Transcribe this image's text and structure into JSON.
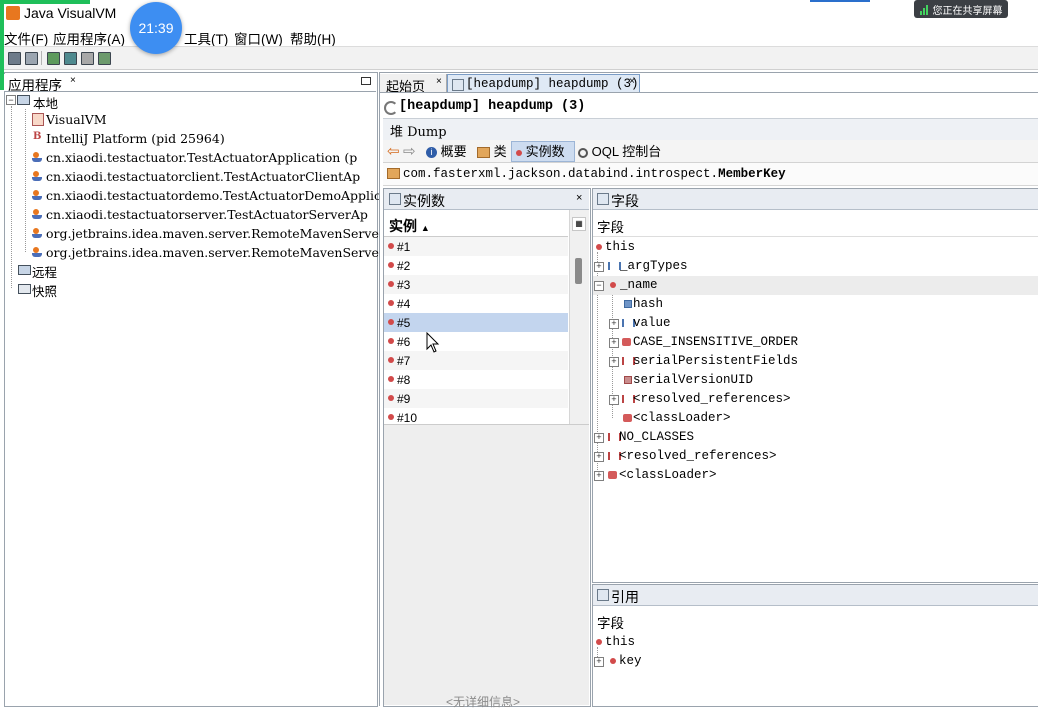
{
  "window": {
    "title": "Java VisualVM",
    "clock": "21:39",
    "share_notice": "您正在共享屏幕"
  },
  "menu": [
    {
      "label": "文件(F)"
    },
    {
      "label": "应用程序(A)"
    },
    {
      "label": "工具(T)"
    },
    {
      "label": "窗口(W)"
    },
    {
      "label": "帮助(H)"
    }
  ],
  "left_panel": {
    "tab_label": "应用程序",
    "tab_close": "×",
    "local_label": "本地",
    "apps": [
      {
        "label": "VisualVM",
        "icon": "visualvm-icon"
      },
      {
        "label": "IntelliJ Platform (pid 25964)",
        "icon": "intellij-icon"
      },
      {
        "label": "cn.xiaodi.testactuator.TestActuatorApplication (p",
        "icon": "java-process-icon"
      },
      {
        "label": "cn.xiaodi.testactuatorclient.TestActuatorClientAp",
        "icon": "java-process-icon"
      },
      {
        "label": "cn.xiaodi.testactuatordemo.TestActuatorDemoApplic",
        "icon": "java-process-icon"
      },
      {
        "label": "cn.xiaodi.testactuatorserver.TestActuatorServerAp",
        "icon": "java-process-icon"
      },
      {
        "label": "org.jetbrains.idea.maven.server.RemoteMavenServer",
        "icon": "java-process-icon"
      },
      {
        "label": "org.jetbrains.idea.maven.server.RemoteMavenServer",
        "icon": "java-process-icon"
      }
    ],
    "remote_label": "远程",
    "snapshots_label": "快照"
  },
  "doc_tabs": [
    {
      "label": "起始页",
      "close": "×"
    },
    {
      "label": "[heapdump] heapdump (3)",
      "close": "×"
    }
  ],
  "heapdump": {
    "title": "[heapdump] heapdump (3)",
    "dump_label": "堆 Dump",
    "nav": {
      "summary": "概要",
      "classes": "类",
      "instances": "实例数",
      "oql": "OQL 控制台"
    },
    "class_prefix": "com.fasterxml.jackson.databind.introspect.",
    "class_name": "MemberKey"
  },
  "instances_panel": {
    "title": "实例数",
    "close": "×",
    "column": "实例",
    "sort_indicator": "▲",
    "rows": [
      "#1",
      "#2",
      "#3",
      "#4",
      "#5",
      "#6",
      "#7",
      "#8",
      "#9",
      "#10"
    ],
    "selected": "#5",
    "detail_text": "<无详细信息>"
  },
  "fields_panel": {
    "title": "字段",
    "column": "字段",
    "rows": [
      {
        "label": "this",
        "depth": 0,
        "expander": "",
        "icon": "instance-dot-icon"
      },
      {
        "label": "_argTypes",
        "depth": 0,
        "expander": "+",
        "icon": "array-icon"
      },
      {
        "label": "_name",
        "depth": 0,
        "expander": "−",
        "icon": "instance-dot-icon"
      },
      {
        "label": "hash",
        "depth": 1,
        "expander": "",
        "icon": "primitive-field-icon"
      },
      {
        "label": "value",
        "depth": 1,
        "expander": "+",
        "icon": "array-icon"
      },
      {
        "label": "CASE_INSENSITIVE_ORDER",
        "depth": 1,
        "expander": "+",
        "icon": "static-field-icon"
      },
      {
        "label": "serialPersistentFields",
        "depth": 1,
        "expander": "+",
        "icon": "static-array-icon"
      },
      {
        "label": "serialVersionUID",
        "depth": 1,
        "expander": "",
        "icon": "static-primitive-icon"
      },
      {
        "label": "<resolved_references>",
        "depth": 1,
        "expander": "+",
        "icon": "static-array-icon"
      },
      {
        "label": "<classLoader>",
        "depth": 1,
        "expander": "",
        "icon": "static-field-icon"
      },
      {
        "label": "NO_CLASSES",
        "depth": 0,
        "expander": "+",
        "icon": "static-array-icon"
      },
      {
        "label": "<resolved_references>",
        "depth": 0,
        "expander": "+",
        "icon": "static-array-icon"
      },
      {
        "label": "<classLoader>",
        "depth": 0,
        "expander": "+",
        "icon": "static-field-icon"
      }
    ]
  },
  "references_panel": {
    "title": "引用",
    "column": "字段",
    "rows": [
      {
        "label": "this",
        "expander": ""
      },
      {
        "label": "key",
        "expander": "+"
      }
    ]
  }
}
